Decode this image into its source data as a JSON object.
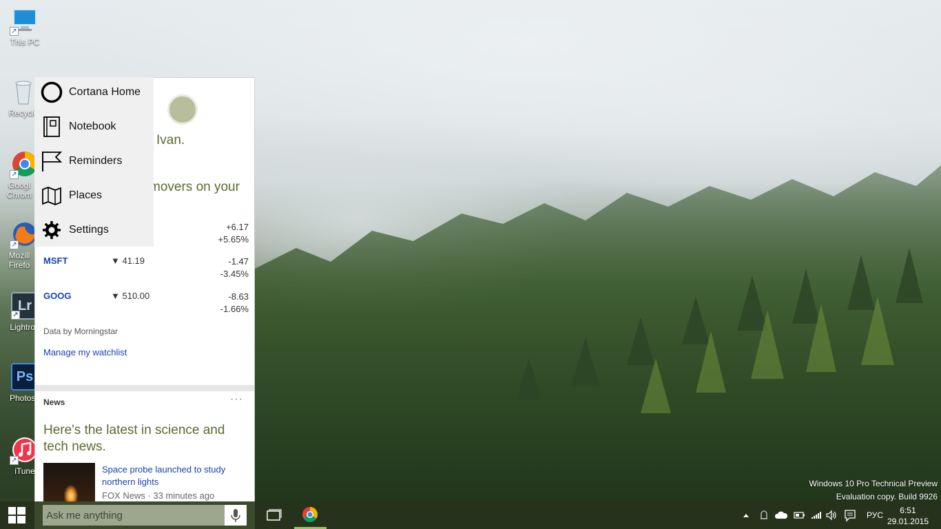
{
  "desktop": {
    "icons": [
      {
        "label": "This PC",
        "icon": "computer-icon"
      },
      {
        "label": "Recycle",
        "icon": "recycle-bin-icon"
      },
      {
        "label": "Googl Chrom",
        "icon": "chrome-icon"
      },
      {
        "label": "Mozill Firefo",
        "icon": "firefox-icon"
      },
      {
        "label": "Lightroo",
        "icon": "lightroom-icon"
      },
      {
        "label": "Photosh",
        "icon": "photoshop-icon"
      },
      {
        "label": "iTune",
        "icon": "itunes-icon"
      }
    ],
    "lightroom_glyph": "Lr",
    "photoshop_glyph": "Ps"
  },
  "cortana": {
    "greeting": "Ivan.",
    "movers_heading": "movers on your",
    "menu": [
      {
        "label": "Cortana Home",
        "icon": "cortana-circle-icon"
      },
      {
        "label": "Notebook",
        "icon": "notebook-icon"
      },
      {
        "label": "Reminders",
        "icon": "flag-icon"
      },
      {
        "label": "Places",
        "icon": "map-icon"
      },
      {
        "label": "Settings",
        "icon": "gear-icon"
      }
    ],
    "stocks": [
      {
        "symbol": "",
        "price": "",
        "change": "+6.17",
        "percent": "+5.65%"
      },
      {
        "symbol": "MSFT",
        "price": "▼ 41.19",
        "change": "-1.47",
        "percent": "-3.45%"
      },
      {
        "symbol": "GOOG",
        "price": "▼ 510.00",
        "change": "-8.63",
        "percent": "-1.66%"
      }
    ],
    "source": "Data by Morningstar",
    "watchlist_link": "Manage my watchlist",
    "news": {
      "header": "News",
      "more": "···",
      "title": "Here's the latest in science and tech news.",
      "item_title": "Space probe launched to study northern lights",
      "item_meta": "FOX News · 33 minutes ago"
    }
  },
  "watermark": {
    "line1": "Windows 10 Pro Technical Preview",
    "line2": "Evaluation copy. Build 9926"
  },
  "taskbar": {
    "search_placeholder": "Ask me anything",
    "tray": {
      "language": "РУС",
      "time": "6:51",
      "date": "29.01.2015"
    }
  },
  "colors": {
    "taskbar": "#26321c",
    "search_area": "#3b4a2a",
    "accent_text": "#5a6a2e",
    "link": "#1a3fb4"
  }
}
